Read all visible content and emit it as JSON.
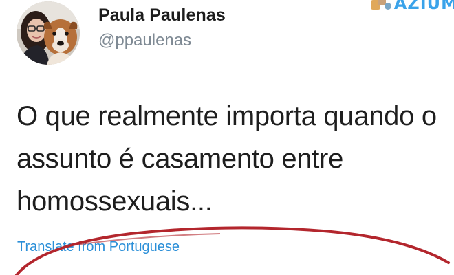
{
  "author": {
    "name": "Paula Paulenas",
    "handle": "@ppaulenas"
  },
  "tweet": {
    "lines": [
      "O que realmente importa quando o",
      "assunto é casamento entre",
      "homossexuais..."
    ]
  },
  "translate_label": "Translate from Portuguese",
  "watermark": {
    "text": "AZIUM"
  },
  "colors": {
    "link": "#2b8fd8",
    "handle": "#7f8a94",
    "annotation_circle": "#b3262d",
    "watermark": "#3aa3ea"
  },
  "icons": {
    "avatar": "profile-photo-avatar",
    "watermark": "site-logo-icon"
  }
}
